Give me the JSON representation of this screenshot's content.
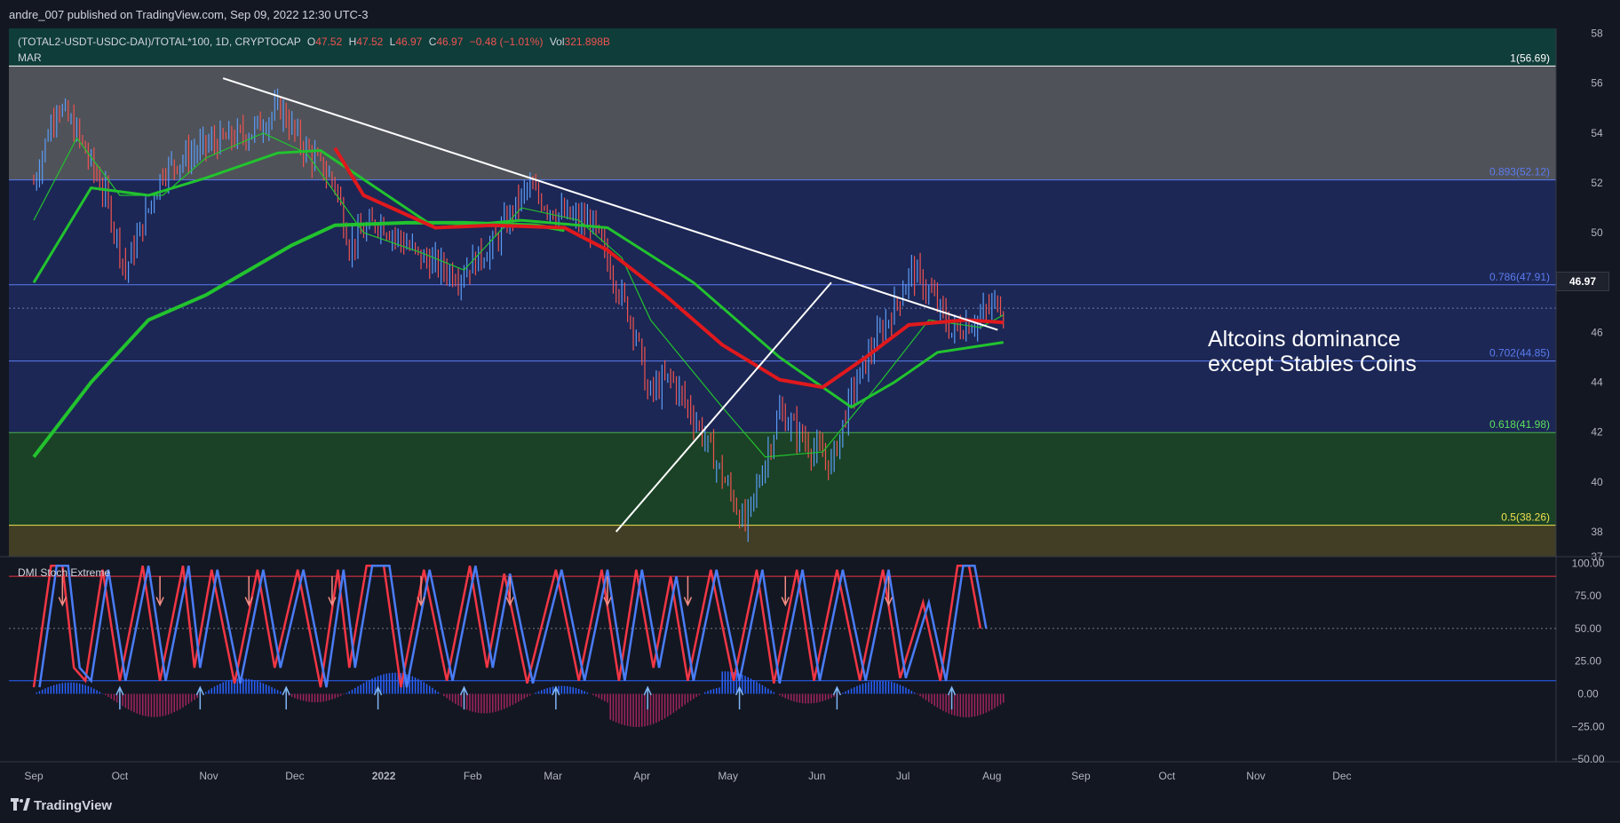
{
  "header": {
    "publisher": "andre_007 published on TradingView.com, Sep 09, 2022 12:30 UTC-3",
    "symbol": "(TOTAL2-USDT-USDC-DAI)/TOTAL*100, 1D, CRYPTOCAP",
    "ohlc": {
      "o_label": "O",
      "o": "47.52",
      "h_label": "H",
      "h": "47.52",
      "l_label": "L",
      "l": "46.97",
      "c_label": "C",
      "c": "46.97",
      "chg": "−0.48 (−1.01%)",
      "vol_label": "Vol",
      "vol": "321.898B"
    },
    "indicator": "MAR"
  },
  "annotation": {
    "line1": "Altcoins dominance",
    "line2": "except Stables Coins"
  },
  "last_price_badge": "46.97",
  "oscillator_label": "DMI Stoch Extreme",
  "footer": {
    "brand": "TradingView"
  },
  "colors": {
    "background": "#131722",
    "up": "#5b9cf6",
    "down": "#ef5350",
    "ma_green": "#22c32e",
    "ma_red": "#e0191d",
    "stoch_k": "#2962ff",
    "stoch_d": "#f23645"
  },
  "chart_data": [
    {
      "type": "line",
      "title": "(TOTAL2-USDT-USDC-DAI)/TOTAL*100, 1D, CRYPTOCAP",
      "x_axis_labels": [
        "Sep",
        "Oct",
        "Nov",
        "Dec",
        "2022",
        "Feb",
        "Mar",
        "Apr",
        "May",
        "Jun",
        "Jul",
        "Aug",
        "Sep",
        "Oct",
        "Nov",
        "Dec"
      ],
      "y_ticks": [
        38,
        40,
        42,
        44,
        46,
        48,
        50,
        52,
        54,
        56,
        58
      ],
      "ylim": [
        37,
        58.2
      ],
      "extra_y_label": "37",
      "series": [
        {
          "values_approx": [
            [
              0,
              52
            ],
            [
              8,
              55.2
            ],
            [
              15,
              54
            ],
            [
              25,
              51.5
            ],
            [
              32,
              48.5
            ],
            [
              45,
              52.5
            ],
            [
              60,
              53.5
            ],
            [
              75,
              54
            ],
            [
              86,
              55
            ],
            [
              93,
              53.6
            ],
            [
              105,
              52
            ],
            [
              110,
              49.5
            ],
            [
              120,
              50.5
            ],
            [
              135,
              49
            ],
            [
              148,
              48.3
            ],
            [
              160,
              49.5
            ],
            [
              172,
              51.8
            ],
            [
              182,
              50.8
            ],
            [
              195,
              50.3
            ],
            [
              203,
              48
            ],
            [
              210,
              46
            ],
            [
              214,
              43.5
            ],
            [
              222,
              44.2
            ],
            [
              232,
              42.2
            ],
            [
              243,
              39.5
            ],
            [
              248,
              38.2
            ],
            [
              254,
              40.5
            ],
            [
              260,
              42.8
            ],
            [
              270,
              41.5
            ],
            [
              278,
              40.7
            ],
            [
              285,
              43.5
            ],
            [
              292,
              45.3
            ],
            [
              300,
              47
            ],
            [
              306,
              48.5
            ],
            [
              313,
              47.5
            ],
            [
              320,
              46
            ],
            [
              330,
              46.6
            ],
            [
              336,
              47.3
            ],
            [
              338,
              46.97
            ]
          ]
        },
        {
          "name": "MA fast (green)",
          "values_approx": [
            [
              0,
              50.5
            ],
            [
              15,
              53.8
            ],
            [
              30,
              51.5
            ],
            [
              45,
              51.5
            ],
            [
              60,
              53
            ],
            [
              80,
              54
            ],
            [
              95,
              53.2
            ],
            [
              115,
              50
            ],
            [
              135,
              49.2
            ],
            [
              150,
              48.5
            ],
            [
              170,
              51
            ],
            [
              190,
              50.5
            ],
            [
              205,
              49
            ],
            [
              215,
              46.5
            ],
            [
              240,
              43
            ],
            [
              255,
              41
            ],
            [
              275,
              41.2
            ],
            [
              295,
              44
            ],
            [
              312,
              46.5
            ],
            [
              330,
              46.2
            ],
            [
              338,
              46.7
            ]
          ]
        },
        {
          "name": "MA mid (green)",
          "values_approx": [
            [
              0,
              48
            ],
            [
              20,
              51.8
            ],
            [
              40,
              51.5
            ],
            [
              60,
              52.2
            ],
            [
              85,
              53.2
            ],
            [
              100,
              53.3
            ],
            [
              140,
              50.2
            ],
            [
              170,
              50.5
            ],
            [
              200,
              50.2
            ],
            [
              230,
              48
            ],
            [
              260,
              45
            ],
            [
              285,
              43
            ],
            [
              300,
              44
            ],
            [
              315,
              45.2
            ],
            [
              338,
              45.6
            ]
          ]
        },
        {
          "name": "MA slow (green)",
          "values_approx": [
            [
              0,
              41
            ],
            [
              20,
              44
            ],
            [
              40,
              46.5
            ],
            [
              60,
              47.5
            ],
            [
              90,
              49.5
            ],
            [
              105,
              50.3
            ],
            [
              130,
              50.4
            ],
            [
              150,
              50.4
            ],
            [
              175,
              50.3
            ],
            [
              185,
              50.1
            ]
          ]
        },
        {
          "name": "MA (red)",
          "values_approx": [
            [
              105,
              53.4
            ],
            [
              115,
              51.5
            ],
            [
              140,
              50.2
            ],
            [
              160,
              50.3
            ],
            [
              185,
              50.2
            ],
            [
              200,
              49.3
            ],
            [
              220,
              47.5
            ],
            [
              240,
              45.5
            ],
            [
              260,
              44.1
            ],
            [
              275,
              43.8
            ],
            [
              290,
              45
            ],
            [
              305,
              46.3
            ],
            [
              325,
              46.5
            ],
            [
              338,
              46.4
            ]
          ]
        }
      ],
      "fib_levels": [
        {
          "label": "1(56.69)",
          "value": 56.69
        },
        {
          "label": "0.893(52.12)",
          "value": 52.12
        },
        {
          "label": "0.786(47.91)",
          "value": 47.91
        },
        {
          "label": "0.702(44.85)",
          "value": 44.85
        },
        {
          "label": "0.618(41.98)",
          "value": 41.98
        },
        {
          "label": "0.5(38.26)",
          "value": 38.26
        }
      ],
      "trendlines": [
        {
          "from": [
            66,
            56.2
          ],
          "to": [
            336,
            46.1
          ]
        },
        {
          "from": [
            203,
            38
          ],
          "to": [
            278,
            48
          ]
        }
      ]
    },
    {
      "type": "line",
      "title": "DMI Stoch Extreme",
      "y_ticks": [
        "100.00",
        "75.00",
        "50.00",
        "25.00",
        "0.00",
        "−25.00",
        "−50.00"
      ],
      "ylim": [
        -52,
        105
      ],
      "levels": [
        90,
        50,
        10
      ],
      "series": [
        {
          "name": "%K",
          "values_approx": [
            [
              0,
              5
            ],
            [
              6,
              98
            ],
            [
              10,
              98
            ],
            [
              14,
              20
            ],
            [
              18,
              10
            ],
            [
              24,
              95
            ],
            [
              30,
              10
            ],
            [
              38,
              98
            ],
            [
              44,
              10
            ],
            [
              52,
              98
            ],
            [
              56,
              20
            ],
            [
              62,
              95
            ],
            [
              70,
              8
            ],
            [
              78,
              95
            ],
            [
              84,
              20
            ],
            [
              92,
              95
            ],
            [
              100,
              5
            ],
            [
              106,
              95
            ],
            [
              110,
              20
            ],
            [
              116,
              98
            ],
            [
              122,
              98
            ],
            [
              128,
              5
            ],
            [
              136,
              95
            ],
            [
              144,
              10
            ],
            [
              152,
              98
            ],
            [
              158,
              20
            ],
            [
              164,
              92
            ],
            [
              172,
              8
            ],
            [
              182,
              95
            ],
            [
              190,
              10
            ],
            [
              198,
              95
            ],
            [
              204,
              10
            ],
            [
              210,
              95
            ],
            [
              216,
              20
            ],
            [
              222,
              90
            ],
            [
              228,
              10
            ],
            [
              236,
              95
            ],
            [
              244,
              10
            ],
            [
              252,
              95
            ],
            [
              258,
              8
            ],
            [
              266,
              95
            ],
            [
              272,
              10
            ],
            [
              280,
              95
            ],
            [
              288,
              10
            ],
            [
              296,
              95
            ],
            [
              302,
              12
            ],
            [
              310,
              70
            ],
            [
              316,
              10
            ],
            [
              322,
              98
            ],
            [
              326,
              98
            ],
            [
              330,
              50
            ]
          ]
        }
      ]
    }
  ]
}
